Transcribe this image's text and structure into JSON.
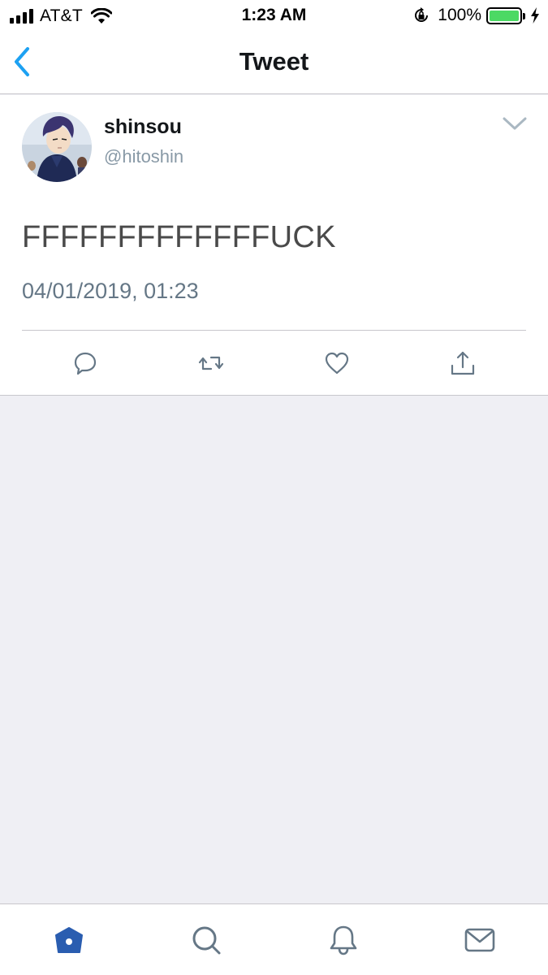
{
  "status_bar": {
    "carrier": "AT&T",
    "time": "1:23 AM",
    "battery_percent": "100%",
    "battery_level": 1.0,
    "signal_bars": 4,
    "icons": [
      "wifi-icon",
      "rotation-lock-icon",
      "battery-icon",
      "charging-bolt-icon"
    ]
  },
  "nav": {
    "title": "Tweet",
    "back_icon": "chevron-left-icon"
  },
  "tweet": {
    "display_name": "shinsou",
    "handle": "@hitoshin",
    "text": "FFFFFFFFFFFFFUCK",
    "timestamp": "04/01/2019, 01:23",
    "menu_icon": "chevron-down-icon",
    "actions": [
      "reply-icon",
      "retweet-icon",
      "like-icon",
      "share-icon"
    ]
  },
  "tab_bar": {
    "tabs": [
      "home-icon",
      "search-icon",
      "notifications-icon",
      "messages-icon"
    ],
    "active": "home-icon"
  },
  "colors": {
    "accent": "#1da1f2",
    "active_tab": "#2a5db0",
    "icon_gray": "#657786",
    "handle_gray": "#8899a6",
    "background": "#efeff4",
    "battery_green": "#4cd964"
  }
}
